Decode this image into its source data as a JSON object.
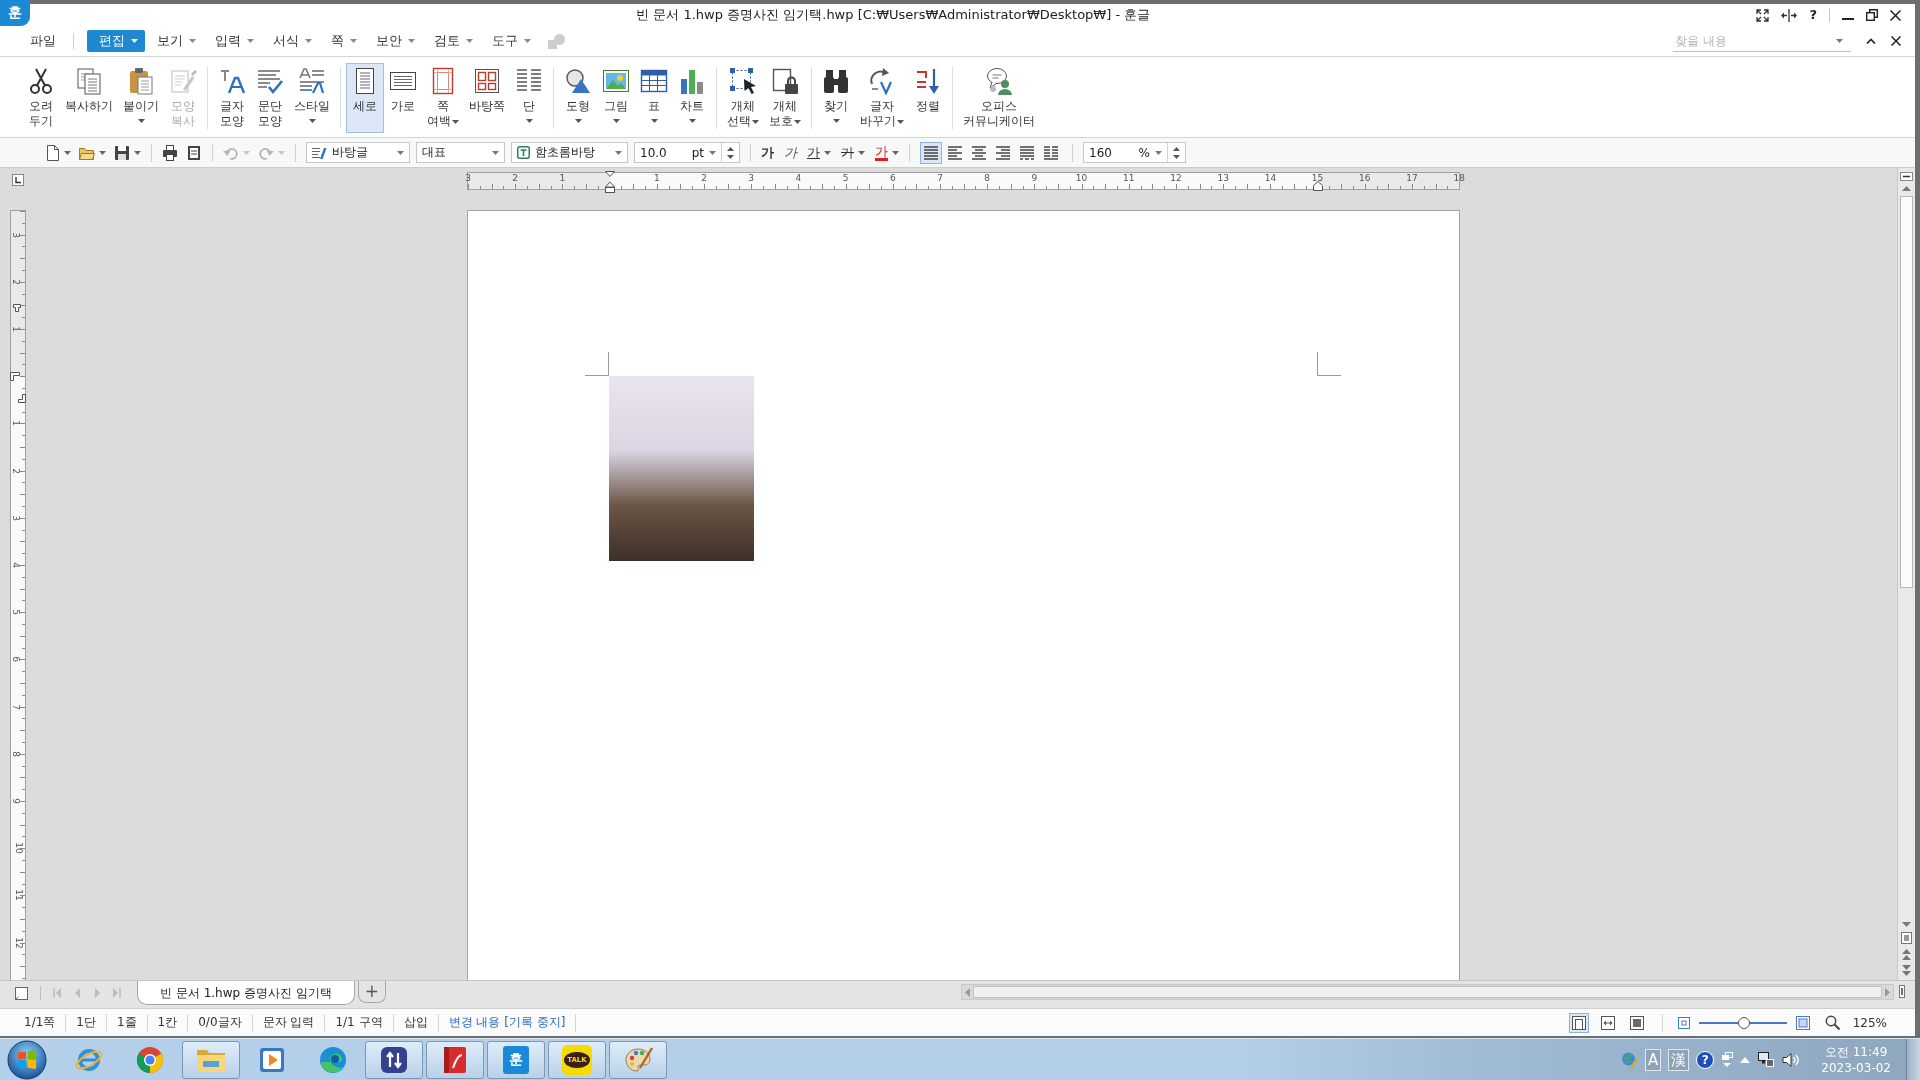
{
  "window": {
    "app_icon": "훈",
    "title": "빈 문서 1.hwp 증명사진 임기택.hwp [C:₩Users₩Administrator₩Desktop₩] - 훈글",
    "help": "?"
  },
  "menu": {
    "items": [
      {
        "label": "파일",
        "selected": false,
        "dropdown": false
      },
      {
        "label": "편집",
        "selected": true,
        "dropdown": true
      },
      {
        "label": "보기",
        "selected": false,
        "dropdown": true
      },
      {
        "label": "입력",
        "selected": false,
        "dropdown": true
      },
      {
        "label": "서식",
        "selected": false,
        "dropdown": true
      },
      {
        "label": "쪽",
        "selected": false,
        "dropdown": true
      },
      {
        "label": "보안",
        "selected": false,
        "dropdown": true
      },
      {
        "label": "검토",
        "selected": false,
        "dropdown": true
      },
      {
        "label": "도구",
        "selected": false,
        "dropdown": true
      }
    ],
    "extra_button": {
      "disabled": true
    },
    "search": {
      "placeholder": "찾을 내용"
    }
  },
  "ribbon": {
    "groups": [
      [
        {
          "lines": [
            "오려",
            "두기"
          ],
          "dropdown": false,
          "selected": false,
          "disabled": false
        },
        {
          "lines": [
            "복사하기"
          ],
          "dropdown": false,
          "selected": false,
          "disabled": false
        },
        {
          "lines": [
            "붙이기"
          ],
          "dropdown": true,
          "selected": false,
          "disabled": false
        },
        {
          "lines": [
            "모양",
            "복사"
          ],
          "dropdown": false,
          "selected": false,
          "disabled": true
        }
      ],
      [
        {
          "lines": [
            "글자",
            "모양"
          ],
          "dropdown": false,
          "selected": false,
          "disabled": false
        },
        {
          "lines": [
            "문단",
            "모양"
          ],
          "dropdown": false,
          "selected": false,
          "disabled": false
        },
        {
          "lines": [
            "스타일"
          ],
          "dropdown": true,
          "selected": false,
          "disabled": false
        }
      ],
      [
        {
          "lines": [
            "세로"
          ],
          "dropdown": false,
          "selected": true,
          "disabled": false
        },
        {
          "lines": [
            "가로"
          ],
          "dropdown": false,
          "selected": false,
          "disabled": false
        },
        {
          "lines": [
            "쪽",
            "여백"
          ],
          "dropdown": true,
          "selected": false,
          "disabled": false
        },
        {
          "lines": [
            "바탕쪽"
          ],
          "dropdown": false,
          "selected": false,
          "disabled": false
        },
        {
          "lines": [
            "단"
          ],
          "dropdown": true,
          "selected": false,
          "disabled": false
        }
      ],
      [
        {
          "lines": [
            "도형"
          ],
          "dropdown": true,
          "selected": false,
          "disabled": false
        },
        {
          "lines": [
            "그림"
          ],
          "dropdown": true,
          "selected": false,
          "disabled": false
        },
        {
          "lines": [
            "표"
          ],
          "dropdown": true,
          "selected": false,
          "disabled": false
        },
        {
          "lines": [
            "차트"
          ],
          "dropdown": true,
          "selected": false,
          "disabled": false
        }
      ],
      [
        {
          "lines": [
            "개체",
            "선택"
          ],
          "dropdown": true,
          "selected": false,
          "disabled": false
        },
        {
          "lines": [
            "개체",
            "보호"
          ],
          "dropdown": true,
          "selected": false,
          "disabled": false
        }
      ],
      [
        {
          "lines": [
            "찾기"
          ],
          "dropdown": true,
          "selected": false,
          "disabled": false
        },
        {
          "lines": [
            "글자",
            "바꾸기"
          ],
          "dropdown": true,
          "selected": false,
          "disabled": false
        },
        {
          "lines": [
            "정렬"
          ],
          "dropdown": false,
          "selected": false,
          "disabled": false
        }
      ],
      [
        {
          "lines": [
            "오피스",
            "커뮤니케이터"
          ],
          "dropdown": false,
          "selected": false,
          "disabled": false
        }
      ]
    ]
  },
  "toolbar": {
    "groups": [
      [
        {
          "dropdown": true,
          "disabled": false
        },
        {
          "dropdown": true,
          "disabled": false
        },
        {
          "dropdown": true,
          "disabled": false
        }
      ],
      [
        {
          "dropdown": false,
          "disabled": false
        },
        {
          "dropdown": false,
          "disabled": false
        }
      ],
      [
        {
          "dropdown": true,
          "disabled": true
        },
        {
          "dropdown": true,
          "disabled": true
        }
      ]
    ],
    "style": "바탕글",
    "language": "대표",
    "font": "함초롬바탕",
    "size": {
      "value": "10.0",
      "unit": "pt"
    },
    "char_buttons": [
      {
        "label": "가",
        "kind": "bold",
        "dropdown": false
      },
      {
        "label": "가",
        "kind": "italic",
        "dropdown": false
      },
      {
        "label": "가",
        "kind": "underline",
        "dropdown": true
      },
      {
        "label": "가",
        "kind": "strike",
        "dropdown": true
      },
      {
        "label": "가",
        "kind": "color",
        "dropdown": true
      }
    ],
    "align_buttons": [
      {
        "selected": true
      },
      {
        "selected": false
      },
      {
        "selected": false
      },
      {
        "selected": false
      },
      {
        "selected": false
      },
      {
        "selected": false
      }
    ],
    "zoom": {
      "value": "160",
      "unit": "%"
    }
  },
  "ruler": {
    "h_before": [
      "3",
      "2",
      "1"
    ],
    "h_after": [
      "1",
      "2",
      "3",
      "4",
      "5",
      "6",
      "7",
      "8",
      "9",
      "10",
      "11",
      "12",
      "13",
      "14",
      "15",
      "16",
      "17",
      "18"
    ],
    "v_before": [
      "3",
      "2",
      "1"
    ],
    "v_after": [
      "1",
      "2",
      "3",
      "4",
      "5",
      "6",
      "7",
      "8",
      "9",
      "10",
      "11",
      "12"
    ]
  },
  "document_tabs": {
    "nav": [
      {
        "disabled": true
      },
      {
        "disabled": true
      },
      {
        "disabled": true
      },
      {
        "disabled": true
      }
    ],
    "tabs": [
      {
        "label": "빈 문서 1.hwp 증명사진 임기택",
        "selected": true
      }
    ],
    "add_label": "+"
  },
  "status_bar": {
    "items": [
      {
        "label": "1/1쪽",
        "kind": "info"
      },
      {
        "label": "1단",
        "kind": "info"
      },
      {
        "label": "1줄",
        "kind": "info"
      },
      {
        "label": "1칸",
        "kind": "info"
      },
      {
        "label": "0/0글자",
        "kind": "info"
      },
      {
        "label": "문자 입력",
        "kind": "info"
      },
      {
        "label": "1/1 구역",
        "kind": "info"
      },
      {
        "label": "삽입",
        "kind": "info"
      },
      {
        "label": "변경 내용 [기록 중지]",
        "kind": "link"
      }
    ],
    "views": [
      {
        "selected": true
      },
      {
        "selected": false
      },
      {
        "selected": false
      }
    ],
    "zoom_slider": {
      "level": 0.52
    },
    "zoom_label": "125%"
  },
  "taskbar": {
    "apps": [
      {
        "running": false
      },
      {
        "running": false
      },
      {
        "running": true
      },
      {
        "running": false
      },
      {
        "running": false
      },
      {
        "running": true
      },
      {
        "running": true
      },
      {
        "running": true,
        "label": "훈"
      },
      {
        "running": true,
        "label": "TALK"
      },
      {
        "running": true
      }
    ],
    "tray": {
      "ime": [
        "A",
        "漢"
      ],
      "help": "?",
      "time": "오전 11:49",
      "date": "2023-03-02"
    }
  }
}
